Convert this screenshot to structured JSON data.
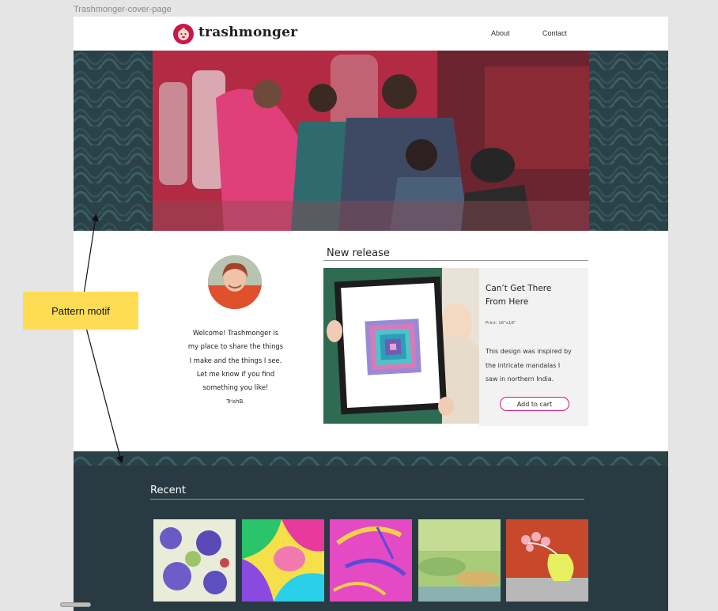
{
  "canvas": {
    "frame_label": "Trashmonger-cover-page"
  },
  "header": {
    "logo_icon": "baby-face-icon",
    "logo_text": "trashmonger",
    "nav": [
      {
        "label": "About"
      },
      {
        "label": "Contact"
      }
    ]
  },
  "hero": {
    "image": "family-on-motorbike-photo"
  },
  "intro": {
    "avatar": "portrait-photo",
    "welcome_lines": [
      "Welcome! Trashmonger is",
      "my place to share the things",
      "I make and the things I see.",
      "Let me know if you find",
      "something you like!"
    ],
    "signature": "TrishB."
  },
  "new_release": {
    "title": "New release",
    "product": {
      "name_lines": [
        "Can’t Get There",
        "From Here"
      ],
      "print_size": "Print: 16\"x16\"",
      "description_lines": [
        "This design was inspired by",
        "the intricate mandalas I",
        "saw in northern India."
      ],
      "cta": "Add to cart"
    }
  },
  "recent": {
    "title": "Recent",
    "thumbnails": [
      "dotted-circles-art",
      "colorful-blobs-art",
      "magenta-strokes-art",
      "green-wash-art",
      "vase-flowers-art"
    ]
  },
  "annotation": {
    "label": "Pattern motif"
  },
  "colors": {
    "brand": "#c8174a",
    "pattern_teal": "#2a4147",
    "dark_band": "#293a42",
    "cta_border": "#d01a7e",
    "annotation_yellow": "#fedd55"
  }
}
